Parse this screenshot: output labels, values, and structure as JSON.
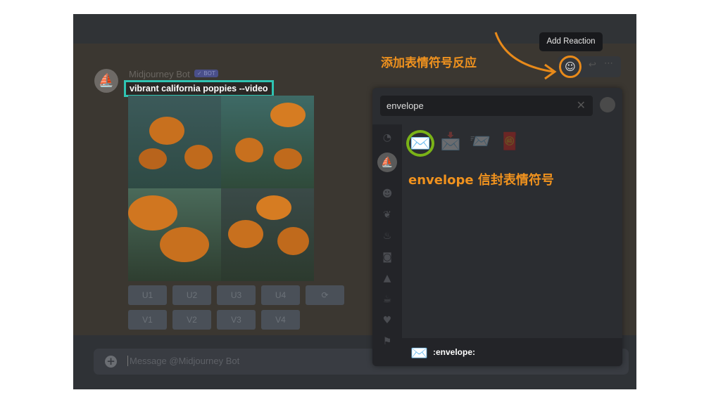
{
  "message": {
    "username": "Midjourney Bot",
    "bot_badge": "✓ BOT",
    "prompt": "vibrant california poppies --video",
    "buttons_row1": [
      "U1",
      "U2",
      "U3",
      "U4",
      "⟳"
    ],
    "buttons_row2": [
      "V1",
      "V2",
      "V3",
      "V4"
    ]
  },
  "tooltip": "Add Reaction",
  "annotations": {
    "add_reaction": "添加表情符号反应",
    "envelope": "envelope 信封表情符号"
  },
  "picker": {
    "search_value": "envelope",
    "results": [
      "✉️",
      "📩",
      "📨",
      "🧧"
    ],
    "footer_emoji": "✉️",
    "footer_name": ":envelope:"
  },
  "composer": {
    "placeholder": "Message @Midjourney Bot"
  },
  "colors": {
    "annotation": "#f0921e",
    "prompt_highlight": "#2fc4b2",
    "selection_ring": "#7ab317"
  }
}
